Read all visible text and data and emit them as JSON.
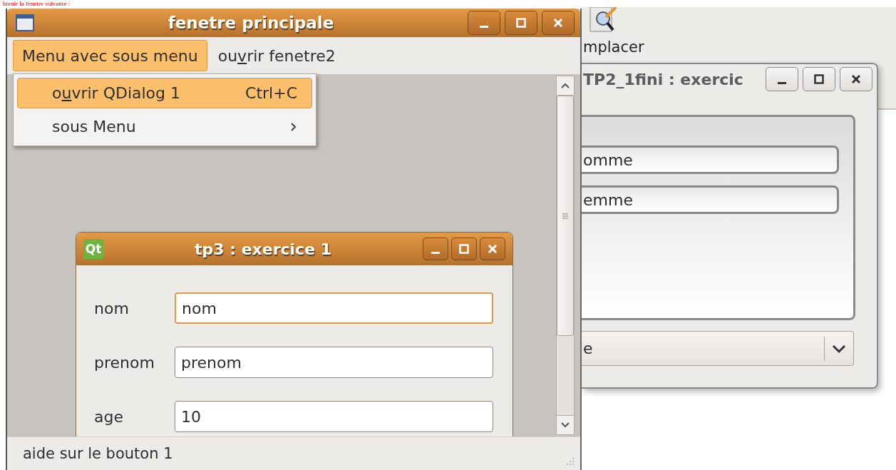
{
  "caption": "btenir la fenetre suivante :",
  "background_app": {
    "toolbar_label": "mplacer"
  },
  "right_window": {
    "title": "TP2_1fini : exercic",
    "active": false,
    "fields": [
      {
        "value": "omme"
      },
      {
        "value": "emme"
      }
    ],
    "combo": {
      "value": "e"
    }
  },
  "main_window": {
    "title": "fenetre principale",
    "active": true,
    "menubar": [
      {
        "label": [
          "Menu avec sous menu"
        ],
        "selected": true
      },
      {
        "label": [
          "ou",
          "v",
          "rir fenetre2"
        ],
        "selected": false
      }
    ],
    "menu": [
      {
        "kind": "action",
        "label": [
          "o",
          "u",
          "vrir QDialog 1"
        ],
        "shortcut": "Ctrl+C",
        "selected": true
      },
      {
        "kind": "submenu",
        "label": [
          "sous Menu"
        ],
        "selected": false
      }
    ],
    "status_bar": "aide sur le bouton 1"
  },
  "dialog": {
    "icon_text": "Qt",
    "title": "tp3 : exercice 1",
    "active": true,
    "rows": [
      {
        "label": "nom",
        "value": "nom",
        "focused": true
      },
      {
        "label": "prenom",
        "value": "prenom",
        "focused": false
      },
      {
        "label": "age",
        "value": "10",
        "focused": false
      }
    ]
  }
}
